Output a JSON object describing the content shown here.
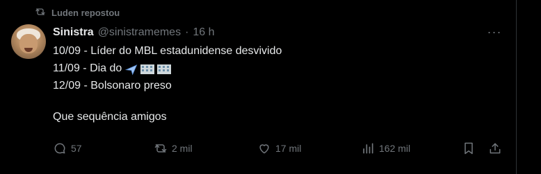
{
  "repost_banner": {
    "text": "Luden repostou"
  },
  "tweet": {
    "author_name": "Sinistra",
    "handle": "@sinistramemes",
    "separator": "·",
    "time": "16 h",
    "more_label": "···",
    "lines": [
      {
        "text": "10/09 - Líder do MBL estadunidense desvivido"
      },
      {
        "text": "11/09 - Dia do"
      },
      {
        "text": "12/09 - Bolsonaro preso"
      },
      {
        "text": ""
      },
      {
        "text": "Que sequência amigos"
      }
    ],
    "emojis_line2": [
      "airplane-emoji",
      "office-building-emoji",
      "office-building-emoji"
    ]
  },
  "actions": {
    "replies": "57",
    "reposts": "2 mil",
    "likes": "17 mil",
    "views": "162 mil"
  },
  "icons": {
    "repost": "repost-icon",
    "reply": "reply-icon",
    "like": "heart-icon",
    "views": "views-icon",
    "bookmark": "bookmark-icon",
    "share": "share-icon"
  },
  "colors": {
    "background": "#000000",
    "text": "#e7e9ea",
    "muted": "#71767b",
    "border": "#2f3336"
  }
}
